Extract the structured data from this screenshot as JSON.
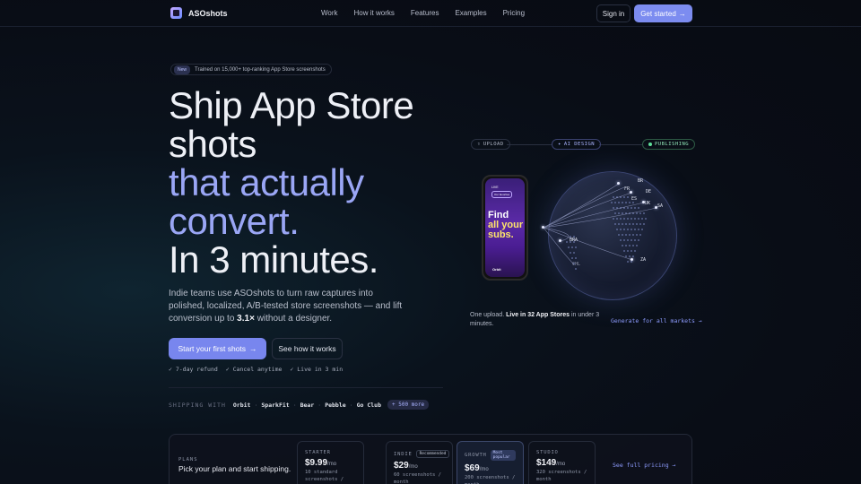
{
  "nav": {
    "brand": "ASOshots",
    "links": [
      "Work",
      "How it works",
      "Features",
      "Examples",
      "Pricing"
    ],
    "signin": "Sign in",
    "get_started": "Get started",
    "arrow": "→"
  },
  "hero": {
    "badge_new": "New",
    "badge_text": "Trained on 15,000+ top-ranking App Store screenshots",
    "headline": [
      "Ship App Store",
      "shots",
      "that actually",
      "convert.",
      "In 3 minutes."
    ],
    "sub_pre": "Indie teams use ASOshots to turn raw captures into polished, localized, A/B-tested store screenshots — and lift conversion up to ",
    "sub_bold": "3.1×",
    "sub_post": " without a designer.",
    "cta_primary": "Start your first shots",
    "cta_secondary": "See how it works",
    "checks": [
      "✓ 7-day refund",
      "✓ Cancel anytime",
      "✓ Live in 3 min"
    ],
    "shipping_label": "SHIPPING WITH",
    "brands": [
      "Orbit",
      "SparkFit",
      "Bear",
      "Pebble",
      "Go Club"
    ],
    "more": "+ 500 more"
  },
  "pipeline": {
    "upload": "UPLOAD",
    "ai": "AI DESIGN",
    "publishing": "PUBLISHING"
  },
  "phone": {
    "live": "LIVE",
    "fav": "Our favorites",
    "find_1": "Find",
    "find_2": "all your",
    "find_3": "subs.",
    "brand": "Orbit"
  },
  "markets": [
    "BR",
    "DE",
    "FR",
    "UK",
    "ES",
    "SA",
    "BRA",
    "ZA",
    "CHL"
  ],
  "upload_note": {
    "pre": "One upload. ",
    "bold": "Live in 32 App Stores",
    "post": " in under 3 minutes."
  },
  "generate_all": "Generate for all markets →",
  "pricing": {
    "label": "PLANS",
    "title": "Pick your plan and start shipping.",
    "plans": [
      {
        "name": "STARTER",
        "tag": "",
        "price": "$9.99",
        "per": "/mo",
        "desc": "10 standard screenshots / month"
      },
      {
        "name": "INDIE",
        "tag": "Recommended",
        "price": "$29",
        "per": "/mo",
        "desc": "60 screenshots / month"
      },
      {
        "name": "GROWTH",
        "tag": "Most popular",
        "price": "$69",
        "per": "/mo",
        "desc": "200 screenshots / month"
      },
      {
        "name": "STUDIO",
        "tag": "",
        "price": "$149",
        "per": "/mo",
        "desc": "320 screenshots / month"
      }
    ],
    "see_full": "See full pricing →"
  },
  "colors": {
    "accent": "#7c8cf0",
    "accent_text": "#9aa6f5",
    "publishing": "#8fe2b5"
  }
}
